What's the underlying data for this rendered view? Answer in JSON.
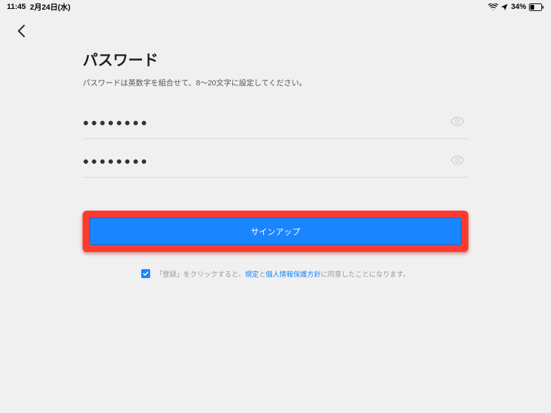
{
  "status": {
    "time": "11:45",
    "date": "2月24日(水)",
    "battery_pct": "34%"
  },
  "page": {
    "title": "パスワード",
    "subtitle": "パスワードは英数字を組合せて、8〜20文字に設定してください。"
  },
  "fields": {
    "password_mask": "●●●●●●●●",
    "confirm_mask": "●●●●●●●●"
  },
  "button": {
    "signup": "サインアップ"
  },
  "consent": {
    "prefix": "「登録」をクリックすると、",
    "terms": "規定",
    "and": "と",
    "privacy": "個人情報保護方針",
    "suffix": "に同意したことになります。"
  }
}
